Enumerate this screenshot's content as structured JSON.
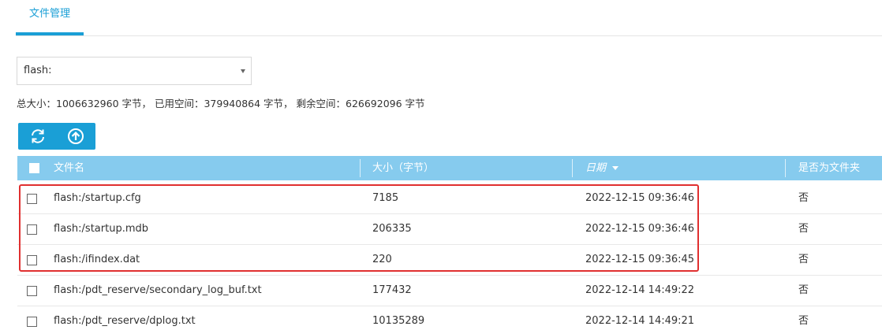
{
  "tabs": [
    {
      "label": "文件管理",
      "active": true
    }
  ],
  "storage_select": {
    "value": "flash:"
  },
  "summary": {
    "text": "总大小：1006632960 字节， 已用空间：379940864 字节， 剩余空间：626692096 字节"
  },
  "toolbar": {
    "refresh_icon": "refresh-icon",
    "upload_icon": "upload-icon"
  },
  "table": {
    "columns": {
      "name": "文件名",
      "size": "大小（字节）",
      "date": "日期",
      "is_folder": "是否为文件夹"
    },
    "sort": {
      "column": "date",
      "direction": "desc"
    },
    "rows": [
      {
        "name": "flash:/startup.cfg",
        "size": "7185",
        "date": "2022-12-15 09:36:46",
        "is_folder": "否"
      },
      {
        "name": "flash:/startup.mdb",
        "size": "206335",
        "date": "2022-12-15 09:36:46",
        "is_folder": "否"
      },
      {
        "name": "flash:/ifindex.dat",
        "size": "220",
        "date": "2022-12-15 09:36:45",
        "is_folder": "否"
      },
      {
        "name": "flash:/pdt_reserve/secondary_log_buf.txt",
        "size": "177432",
        "date": "2022-12-14 14:49:22",
        "is_folder": "否"
      },
      {
        "name": "flash:/pdt_reserve/dplog.txt",
        "size": "10135289",
        "date": "2022-12-14 14:49:21",
        "is_folder": "否"
      }
    ]
  },
  "colors": {
    "accent": "#1a9fd6",
    "header_bg": "#86cbee",
    "highlight": "#e03030"
  }
}
